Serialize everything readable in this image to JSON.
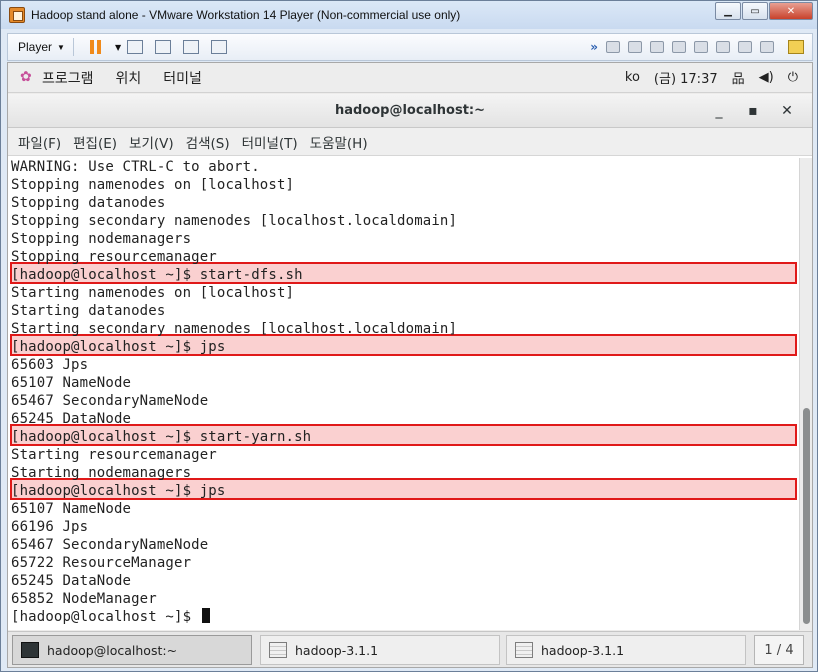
{
  "vm_window": {
    "title": "Hadoop stand alone - VMware Workstation 14 Player (Non-commercial use only)",
    "controls": {
      "minimize": "▁",
      "maximize": "▭",
      "close": "✕"
    }
  },
  "vm_toolbar": {
    "player_label": "Player",
    "icons": [
      "pause-icon",
      "send-ctrl-alt-del-icon",
      "removable-devices-icon",
      "fullscreen-icon",
      "unity-icon"
    ],
    "device_icons": [
      "network-adapter-icon",
      "cd-dvd-icon",
      "usb-icon",
      "printer-icon",
      "sound-icon",
      "hdd-icon",
      "floppy-icon",
      "display-icon",
      "message-log-icon"
    ]
  },
  "gnome_topbar": {
    "menus": [
      "프로그램",
      "위치",
      "터미널"
    ],
    "input_method": "ko",
    "clock": "(금) 17:37"
  },
  "terminal": {
    "title": "hadoop@localhost:~",
    "controls": {
      "minimize": "_",
      "maximize": "▪",
      "close": "✕"
    },
    "menus": [
      "파일(F)",
      "편집(E)",
      "보기(V)",
      "검색(S)",
      "터미널(T)",
      "도움말(H)"
    ],
    "lines": [
      "WARNING: Use CTRL-C to abort.",
      "Stopping namenodes on [localhost]",
      "Stopping datanodes",
      "Stopping secondary namenodes [localhost.localdomain]",
      "Stopping nodemanagers",
      "Stopping resourcemanager",
      "[hadoop@localhost ~]$ start-dfs.sh",
      "Starting namenodes on [localhost]",
      "Starting datanodes",
      "Starting secondary namenodes [localhost.localdomain]",
      "[hadoop@localhost ~]$ jps",
      "65603 Jps",
      "65107 NameNode",
      "65467 SecondaryNameNode",
      "65245 DataNode",
      "[hadoop@localhost ~]$ start-yarn.sh",
      "Starting resourcemanager",
      "Starting nodemanagers",
      "[hadoop@localhost ~]$ jps",
      "65107 NameNode",
      "66196 Jps",
      "65467 SecondaryNameNode",
      "65722 ResourceManager",
      "65245 DataNode",
      "65852 NodeManager",
      "[hadoop@localhost ~]$ "
    ]
  },
  "taskbar": {
    "items": [
      "hadoop@localhost:~",
      "hadoop-3.1.1",
      "hadoop-3.1.1"
    ],
    "pager": "1 / 4"
  },
  "colors": {
    "highlight_border": "#e01919",
    "highlight_fill": "#f07878"
  }
}
